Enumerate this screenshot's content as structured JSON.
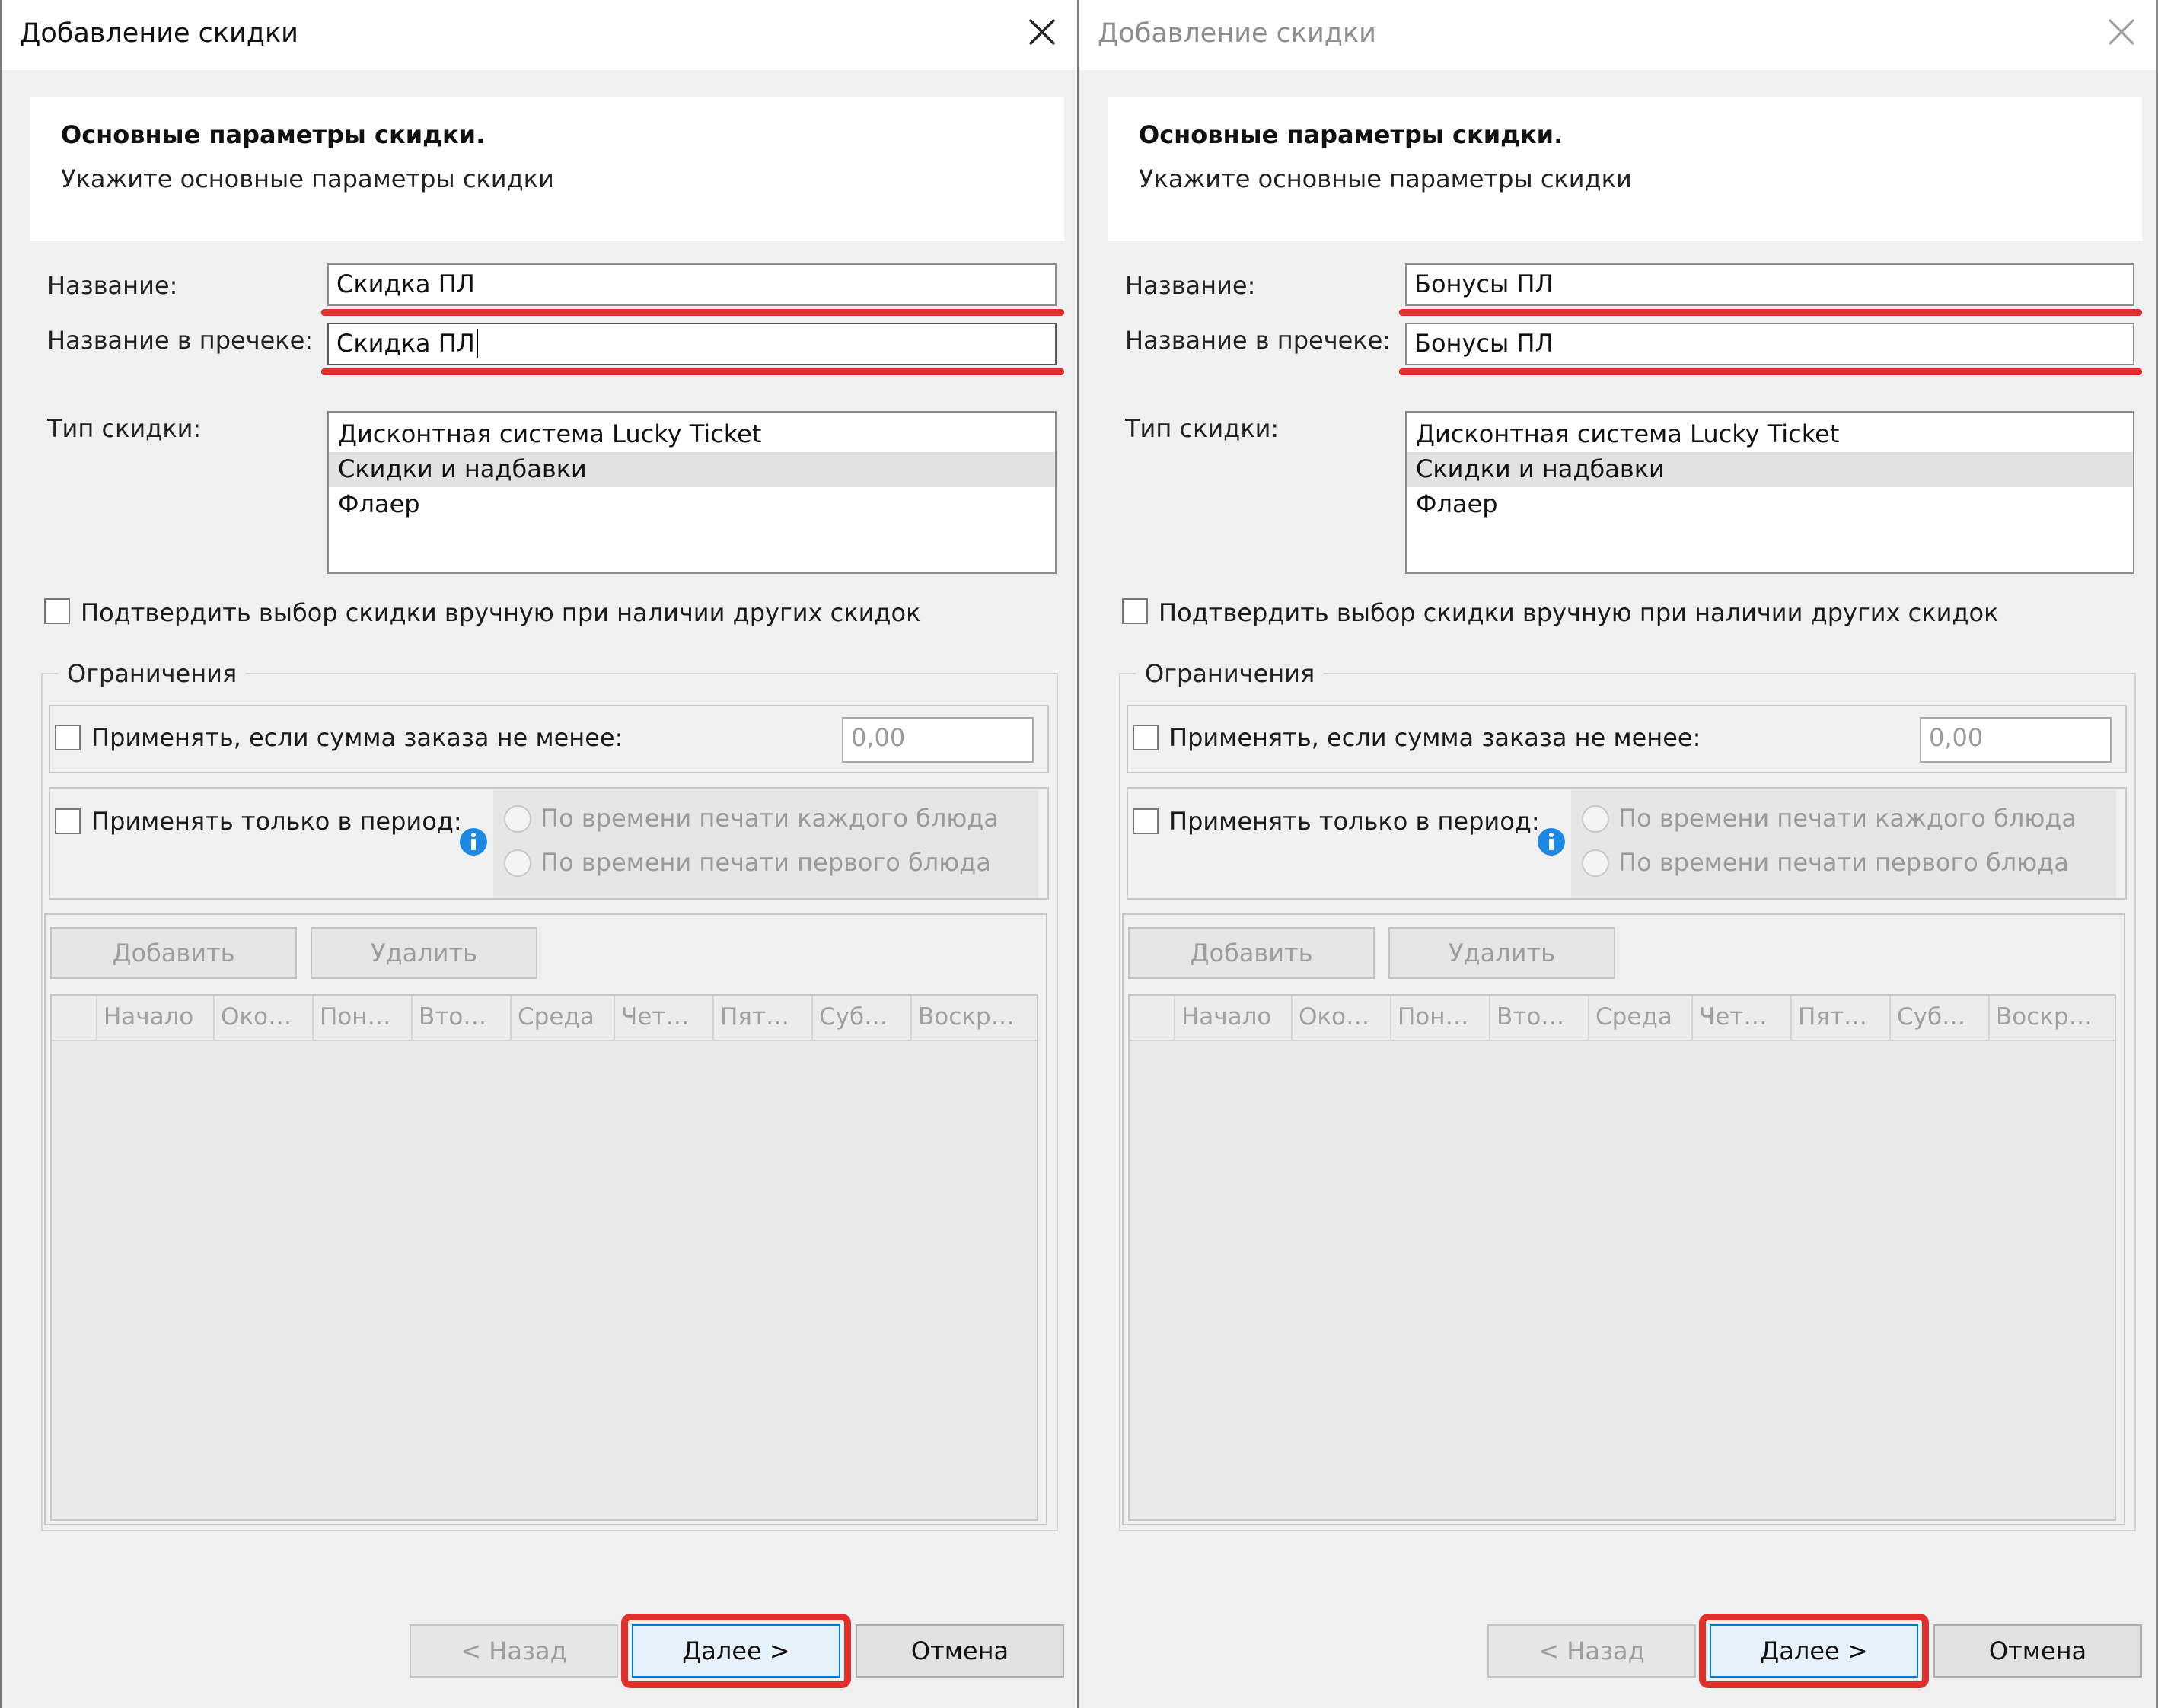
{
  "dialogs": [
    {
      "title": "Добавление скидки",
      "active": true,
      "header": {
        "title": "Основные параметры скидки.",
        "subtitle": "Укажите основные параметры скидки"
      },
      "name_label": "Название:",
      "name_value": "Скидка ПЛ",
      "receipt_label": "Название в пречеке:",
      "receipt_value": "Скидка ПЛ",
      "type_label": "Тип скидки:",
      "type_options": [
        "Дисконтная система Lucky Ticket",
        "Скидки и надбавки",
        "Флаер"
      ],
      "type_selected": "Скидки и надбавки",
      "confirm_label": "Подтвердить выбор скидки вручную при наличии других скидок",
      "limits_title": "Ограничения",
      "min_sum_label": "Применять, если сумма заказа не менее:",
      "min_sum_value": "0,00",
      "period_label": "Применять только в период:",
      "radio_each": "По времени печати каждого блюда",
      "radio_first": "По времени печати первого блюда",
      "add_label": "Добавить",
      "delete_label": "Удалить",
      "columns": [
        "Начало",
        "Око…",
        "Пон…",
        "Вто…",
        "Среда",
        "Чет…",
        "Пят…",
        "Суб…",
        "Воскр…"
      ],
      "back_label": "< Назад",
      "next_label": "Далее >",
      "cancel_label": "Отмена"
    },
    {
      "title": "Добавление скидки",
      "active": false,
      "header": {
        "title": "Основные параметры скидки.",
        "subtitle": "Укажите основные параметры скидки"
      },
      "name_label": "Название:",
      "name_value": "Бонусы ПЛ",
      "receipt_label": "Название в пречеке:",
      "receipt_value": "Бонусы ПЛ",
      "type_label": "Тип скидки:",
      "type_options": [
        "Дисконтная система Lucky Ticket",
        "Скидки и надбавки",
        "Флаер"
      ],
      "type_selected": "Скидки и надбавки",
      "confirm_label": "Подтвердить выбор скидки вручную при наличии других скидок",
      "limits_title": "Ограничения",
      "min_sum_label": "Применять, если сумма заказа не менее:",
      "min_sum_value": "0,00",
      "period_label": "Применять только в период:",
      "radio_each": "По времени печати каждого блюда",
      "radio_first": "По времени печати первого блюда",
      "add_label": "Добавить",
      "delete_label": "Удалить",
      "columns": [
        "Начало",
        "Око…",
        "Пон…",
        "Вто…",
        "Среда",
        "Чет…",
        "Пят…",
        "Суб…",
        "Воскр…"
      ],
      "back_label": "< Назад",
      "next_label": "Далее >",
      "cancel_label": "Отмена"
    }
  ],
  "colors": {
    "highlight": "#e0302e",
    "accent": "#0078d7",
    "info": "#1e88e5"
  }
}
